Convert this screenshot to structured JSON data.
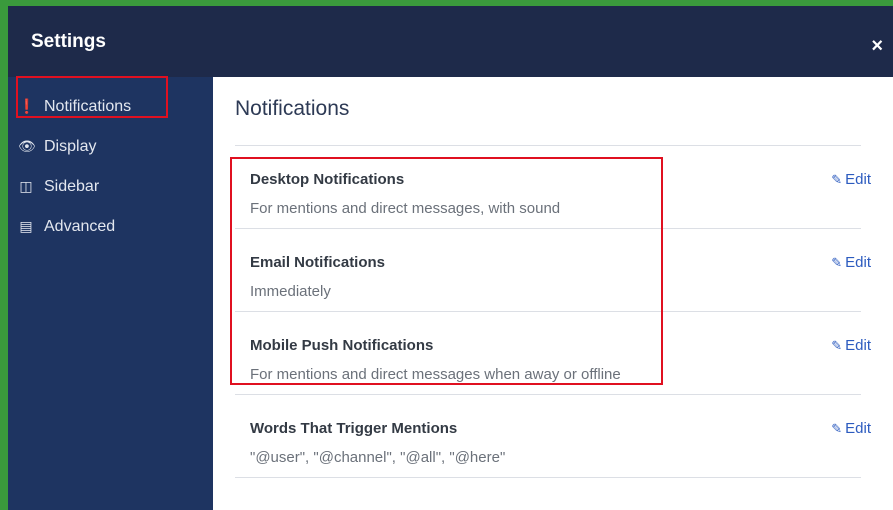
{
  "header": {
    "title": "Settings",
    "close_label": "×"
  },
  "sidebar": {
    "items": [
      {
        "label": "Notifications",
        "icon": "exclamation-circle-icon",
        "glyph": "❗"
      },
      {
        "label": "Display",
        "icon": "eye-icon",
        "glyph": "👁"
      },
      {
        "label": "Sidebar",
        "icon": "columns-icon",
        "glyph": "◫"
      },
      {
        "label": "Advanced",
        "icon": "list-icon",
        "glyph": "▤"
      }
    ]
  },
  "main": {
    "title": "Notifications",
    "edit_label": "Edit",
    "settings": [
      {
        "name": "Desktop Notifications",
        "desc": "For mentions and direct messages, with sound"
      },
      {
        "name": "Email Notifications",
        "desc": "Immediately"
      },
      {
        "name": "Mobile Push Notifications",
        "desc": "For mentions and direct messages when away or offline"
      },
      {
        "name": "Words That Trigger Mentions",
        "desc": "\"@user\", \"@channel\", \"@all\", \"@here\""
      }
    ]
  },
  "colors": {
    "header_bg": "#1e2a4a",
    "sidebar_bg": "#1e3461",
    "accent_link": "#2c5bbf",
    "highlight": "#e01020"
  }
}
